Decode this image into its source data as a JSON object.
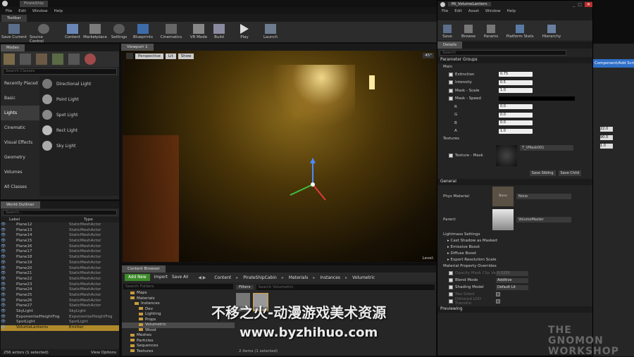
{
  "app": {
    "title": "PirateShip",
    "menu": [
      "File",
      "Edit",
      "Window",
      "Help"
    ],
    "level_tab": "Toolbar"
  },
  "toolbar": {
    "buttons": [
      "Save Current",
      "Source Control",
      "Content",
      "Marketplace",
      "Settings",
      "Blueprints",
      "Cinematics",
      "VR Mode",
      "Build",
      "Play",
      "Launch"
    ]
  },
  "modes": {
    "tab": "Modes",
    "search_placeholder": "Search Classes",
    "categories": [
      "Recently Placed",
      "Basic",
      "Lights",
      "Cinematic",
      "Visual Effects",
      "Geometry",
      "Volumes",
      "All Classes"
    ],
    "active_category": "Lights",
    "actors": [
      "Directional Light",
      "Point Light",
      "Spot Light",
      "Rect Light",
      "Sky Light"
    ]
  },
  "outliner": {
    "tab": "World Outliner",
    "search_placeholder": "Search...",
    "col_label": "Label",
    "col_type": "Type",
    "rows": [
      {
        "label": "Plane12",
        "type": "StaticMeshActor"
      },
      {
        "label": "Plane13",
        "type": "StaticMeshActor"
      },
      {
        "label": "Plane14",
        "type": "StaticMeshActor"
      },
      {
        "label": "Plane15",
        "type": "StaticMeshActor"
      },
      {
        "label": "Plane16",
        "type": "StaticMeshActor"
      },
      {
        "label": "Plane17",
        "type": "StaticMeshActor"
      },
      {
        "label": "Plane18",
        "type": "StaticMeshActor"
      },
      {
        "label": "Plane19",
        "type": "StaticMeshActor"
      },
      {
        "label": "Plane20",
        "type": "StaticMeshActor"
      },
      {
        "label": "Plane21",
        "type": "StaticMeshActor"
      },
      {
        "label": "Plane22",
        "type": "StaticMeshActor"
      },
      {
        "label": "Plane23",
        "type": "StaticMeshActor"
      },
      {
        "label": "Plane24",
        "type": "StaticMeshActor"
      },
      {
        "label": "Plane25",
        "type": "StaticMeshActor"
      },
      {
        "label": "Plane26",
        "type": "StaticMeshActor"
      },
      {
        "label": "Plane27",
        "type": "StaticMeshActor"
      },
      {
        "label": "SkyLight",
        "type": "SkyLight"
      },
      {
        "label": "ExponentialHeightFog",
        "type": "ExponentialHeightFog"
      },
      {
        "label": "SpotLight",
        "type": "SpotLight"
      },
      {
        "label": "VolumeLanterns",
        "type": "Emitter"
      }
    ],
    "selected_row": "VolumeLanterns",
    "status": "256 actors (1 selected)",
    "view_options": "View Options"
  },
  "viewport": {
    "tab": "Viewport 1",
    "perspective": "Perspective",
    "lit": "Lit",
    "show": "Show",
    "angle": "45°",
    "level_label": "Level:"
  },
  "content_browser": {
    "tab": "Content Browser",
    "add_new": "Add New",
    "import": "Import",
    "save_all": "Save All",
    "breadcrumb": [
      "Content",
      "PirateShipCabin",
      "Materials",
      "Instances",
      "Volumetric"
    ],
    "search_folders_placeholder": "Search Folders",
    "filters": "Filters",
    "search_placeholder": "Search Volumetric",
    "folders": [
      "Maps",
      "Materials",
      "Instances",
      "Dev",
      "Lighting",
      "Props",
      "Volumetric",
      "Wood",
      "Meshes",
      "Particles",
      "Sequences",
      "Textures"
    ],
    "selected_folder": "Volumetric",
    "assets": [
      "Volum...",
      "Volumetric..."
    ],
    "items_status": "2 items (1 selected)"
  },
  "editor": {
    "title": "Mi_VolumeLantern",
    "menu": [
      "File",
      "Edit",
      "Asset",
      "Window",
      "Help"
    ],
    "toolbar": [
      "Save",
      "Browse",
      "Params",
      "Platform Stats",
      "Hierarchy"
    ],
    "details_tab": "Details",
    "search_placeholder": "Search",
    "parameter_groups": "Parameter Groups",
    "main_group": "Main",
    "params": [
      {
        "name": "Extinction",
        "value": "0.75"
      },
      {
        "name": "Intensity",
        "value": "0.5"
      },
      {
        "name": "Mask - Scale",
        "value": "1.0"
      }
    ],
    "mask_speed": "Mask - Speed",
    "rgba": [
      {
        "name": "R",
        "value": "0.0"
      },
      {
        "name": "G",
        "value": "0.0"
      },
      {
        "name": "B",
        "value": "0.0"
      },
      {
        "name": "A",
        "value": "1.0"
      }
    ],
    "textures_group": "Textures",
    "texture_mask": "Texture - Mask",
    "texture_value": "T_VMask001",
    "save_sibling": "Save Sibling",
    "save_child": "Save Child",
    "general": "General",
    "phys_material": "Phys Material",
    "phys_value": "None",
    "phys_thumb": "None",
    "parent": "Parent",
    "parent_value": "VolumeMaster",
    "lightmass": "Lightmass Settings",
    "lightmass_items": [
      "Cast Shadow as Masked",
      "Emissive Boost",
      "Diffuse Boost",
      "Export Resolution Scale"
    ],
    "overrides": "Material Property Overrides",
    "override_rows": [
      {
        "name": "Opacity Mask Clip Va",
        "value": "0.3333"
      },
      {
        "name": "Blend Mode",
        "value": "Additive"
      },
      {
        "name": "Shading Model",
        "value": "Default Lit"
      },
      {
        "name": "Two Sided",
        "value": ""
      },
      {
        "name": "Dithered LOD Transitio",
        "value": ""
      }
    ],
    "previewing": "Previewing"
  },
  "right_panel": {
    "add_script": "Component/Add Script",
    "values": [
      "22.0",
      "90.0",
      "1.0"
    ]
  },
  "watermark": {
    "cn": "不移之火-动漫游戏美术资源",
    "url": "www.byzhihuo.com",
    "brand": "THE GNOMON WORKSHOP"
  }
}
